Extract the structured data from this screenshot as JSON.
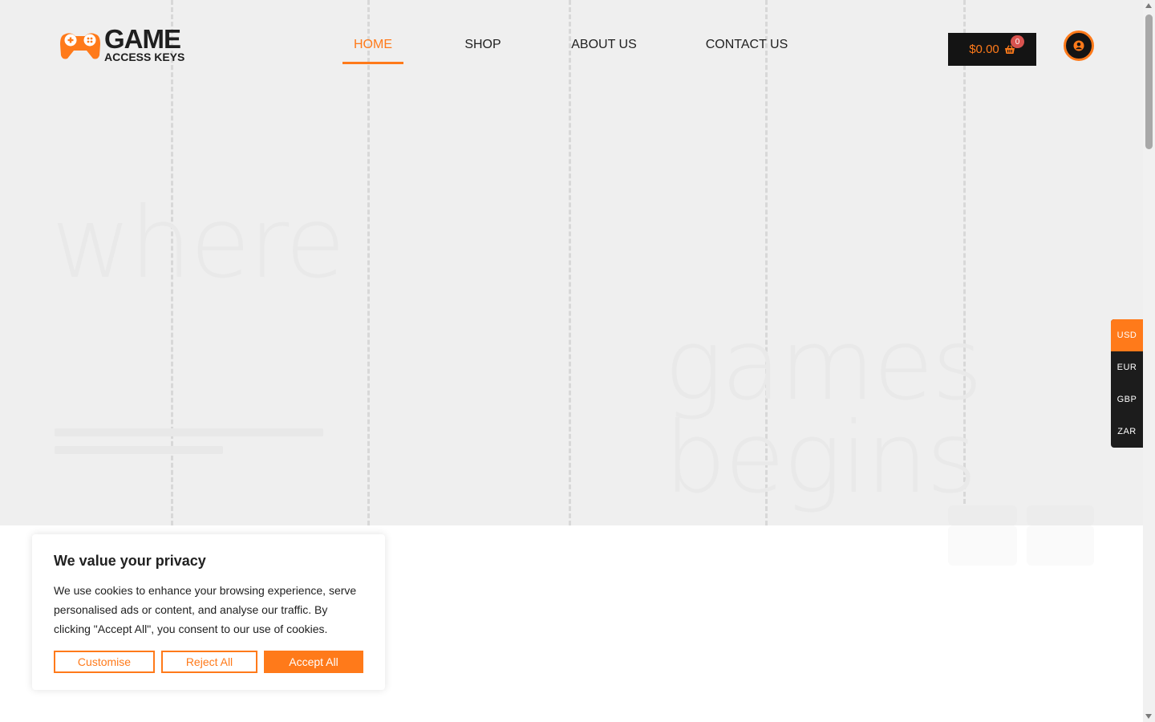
{
  "brand": {
    "name_line1": "GAME",
    "name_line2": "ACCESS KEYS",
    "accent_color": "#ff7a1a",
    "icon": "gamepad-icon"
  },
  "nav": {
    "items": [
      {
        "label": "HOME",
        "active": true
      },
      {
        "label": "SHOP",
        "active": false
      },
      {
        "label": "ABOUT US",
        "active": false
      },
      {
        "label": "CONTACT US",
        "active": false
      }
    ]
  },
  "cart": {
    "total": "$0.00",
    "count": "0",
    "icon": "basket-icon"
  },
  "account": {
    "icon": "user-circle-icon"
  },
  "hero": {
    "word1": "where",
    "word2": "games",
    "word3": "begins"
  },
  "currency_switcher": {
    "options": [
      "USD",
      "EUR",
      "GBP",
      "ZAR"
    ],
    "selected": "USD"
  },
  "cookie_banner": {
    "title": "We value your privacy",
    "body": "We use cookies to enhance your browsing experience, serve personalised ads or content, and analyse our traffic. By clicking \"Accept All\", you consent to our use of cookies.",
    "customise_label": "Customise",
    "reject_label": "Reject All",
    "accept_label": "Accept All"
  }
}
